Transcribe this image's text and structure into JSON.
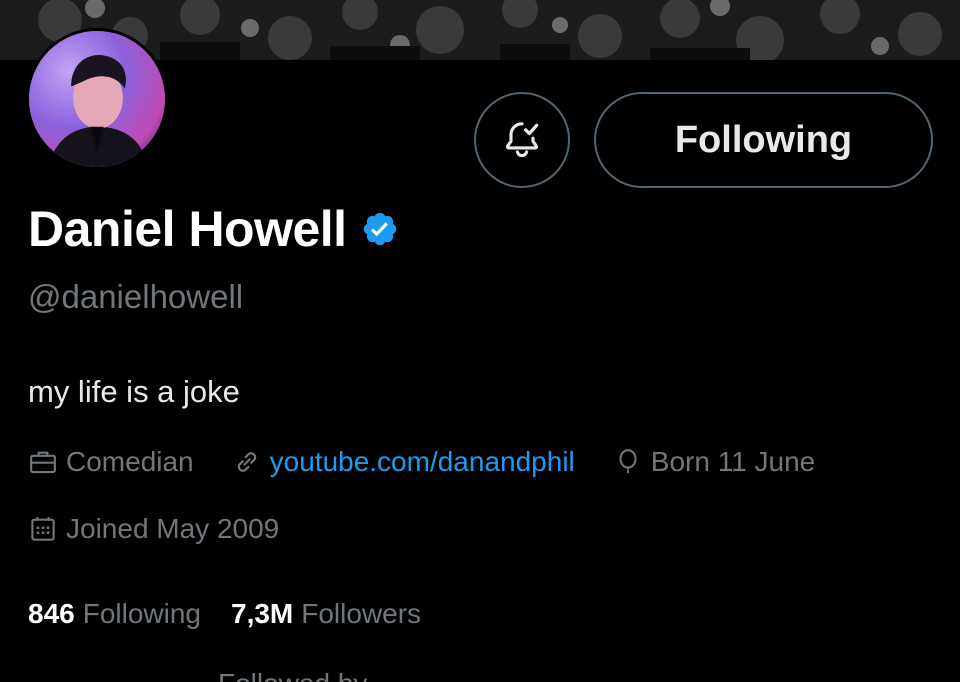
{
  "profile": {
    "display_name": "Daniel Howell",
    "handle": "@danielhowell",
    "bio": "my life is a joke",
    "verified": true
  },
  "actions": {
    "notify_icon": "bell-check-icon",
    "follow_label": "Following"
  },
  "meta": {
    "profession": "Comedian",
    "profession_icon": "briefcase-icon",
    "link": "youtube.com/danandphil",
    "link_icon": "link-icon",
    "birthday": "Born 11 June",
    "birthday_icon": "balloon-icon",
    "joined": "Joined May 2009",
    "joined_icon": "calendar-icon"
  },
  "stats": {
    "following_count": "846",
    "following_label": "Following",
    "followers_count": "7,3M",
    "followers_label": "Followers"
  },
  "followed_by": "Followed by",
  "colors": {
    "accent": "#1d9bf0",
    "muted": "#71767b",
    "border": "#536471",
    "background": "#000000"
  }
}
